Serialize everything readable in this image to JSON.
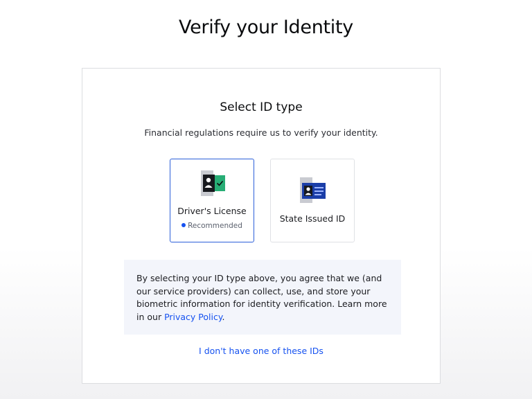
{
  "page": {
    "title": "Verify your Identity"
  },
  "card": {
    "title": "Select ID type",
    "subtitle": "Financial regulations require us to verify your identity."
  },
  "options": [
    {
      "label": "Driver's License",
      "badge": "Recommended",
      "selected": true,
      "icon": "drivers-license-icon"
    },
    {
      "label": "State Issued ID",
      "selected": false,
      "icon": "state-id-card-icon"
    }
  ],
  "consent": {
    "text": "By selecting your ID type above, you agree that we (and our service providers) can collect, use, and store your biometric information for identity verification. Learn more in our ",
    "link": "Privacy Policy",
    "end": "."
  },
  "footer": {
    "no_id_link": "I don't have one of these IDs"
  },
  "colors": {
    "accent": "#1652f0",
    "selected_border": "#2b5fd9",
    "check_green": "#27ad75",
    "consent_bg": "#f3f5fb"
  }
}
